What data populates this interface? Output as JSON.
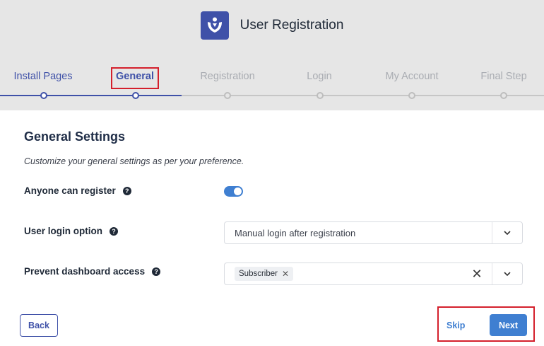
{
  "app": {
    "title": "User Registration",
    "logo_icon": "user-registration-logo-icon"
  },
  "steps": [
    {
      "label": "Install Pages",
      "state": "done"
    },
    {
      "label": "General",
      "state": "current"
    },
    {
      "label": "Registration",
      "state": "pending"
    },
    {
      "label": "Login",
      "state": "pending"
    },
    {
      "label": "My Account",
      "state": "pending"
    },
    {
      "label": "Final Step",
      "state": "pending"
    }
  ],
  "section": {
    "title": "General Settings",
    "description": "Customize your general settings as per your preference."
  },
  "settings": {
    "anyone_can_register": {
      "label": "Anyone can register",
      "enabled": true
    },
    "user_login_option": {
      "label": "User login option",
      "value": "Manual login after registration"
    },
    "prevent_dashboard_access": {
      "label": "Prevent dashboard access",
      "tags": [
        "Subscriber"
      ]
    }
  },
  "actions": {
    "back": "Back",
    "skip": "Skip",
    "next": "Next"
  },
  "colors": {
    "primary": "#3f51a8",
    "accent": "#3f7fd1",
    "highlight": "#d4202c"
  }
}
